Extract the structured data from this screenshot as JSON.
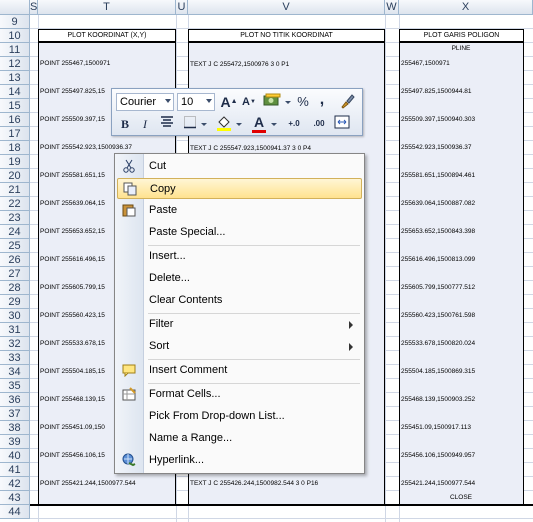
{
  "columns": [
    "S",
    "T",
    "U",
    "V",
    "W",
    "X"
  ],
  "rows": [
    "9",
    "10",
    "11",
    "12",
    "13",
    "14",
    "15",
    "16",
    "17",
    "18",
    "19",
    "20",
    "21",
    "22",
    "23",
    "24",
    "25",
    "26",
    "27",
    "28",
    "29",
    "30",
    "31",
    "32",
    "33",
    "34",
    "35",
    "36",
    "37",
    "38",
    "39",
    "40",
    "41",
    "42",
    "43",
    "44"
  ],
  "headers": {
    "plot_koordinat": "PLOT KOORDINAT (X,Y)",
    "plot_no_titik": "PLOT NO TITIK KOORDINAT",
    "plot_garis": "PLOT GARIS POLIGON"
  },
  "col_t": [
    "POINT 255467,1500971",
    "POINT 255497.825,15",
    "POINT 255509.397,15",
    "POINT 255542.923,1500936.37",
    "POINT 255581.651,15",
    "POINT 255639.064,15",
    "POINT 255653.652,15",
    "POINT 255616.496,15",
    "POINT 255605.799,15",
    "POINT 255560.423,15",
    "POINT 255533.678,15",
    "POINT 255504.185,15",
    "POINT 255468.139,15",
    "POINT 255451.09,150",
    "POINT 255456.106,15",
    "POINT 255421.244,1500977.544"
  ],
  "col_v": [
    "TEXT J C 255472,1500976 3 0  P1",
    "TEXT J C 255547.923,1500941.37 3 0  P4",
    "TEXT J C 255426.244,1500982.544 3 0  P16"
  ],
  "col_x": {
    "pline": "PLINE",
    "close": "CLOSE",
    "values": [
      "255467,1500971",
      "255497.825,1500944.81",
      "255509.397,1500940.303",
      "255542.923,1500936.37",
      "255581.651,1500894.461",
      "255639.064,1500887.082",
      "255653.652,1500843.398",
      "255616.496,1500813.099",
      "255605.799,1500777.512",
      "255560.423,1500761.598",
      "255533.678,1500820.024",
      "255504.185,1500869.315",
      "255468.139,1500903.252",
      "255451.09,1500917.113",
      "255456.106,1500949.957",
      "255421.244,1500977.544"
    ]
  },
  "toolbar": {
    "font": "Courier",
    "size": "10",
    "grow": "A",
    "shrink": "A",
    "percent": "%",
    "comma": ",",
    "bold": "B",
    "italic": "I",
    "font_color_letter": "A",
    "inc_decimal": "+.0",
    "dec_decimal": ".00"
  },
  "menu": {
    "items": [
      {
        "label": "Cut"
      },
      {
        "label": "Copy"
      },
      {
        "label": "Paste"
      },
      {
        "label": "Paste Special..."
      },
      {
        "label": "Insert..."
      },
      {
        "label": "Delete..."
      },
      {
        "label": "Clear Contents"
      },
      {
        "label": "Filter"
      },
      {
        "label": "Sort"
      },
      {
        "label": "Insert Comment"
      },
      {
        "label": "Format Cells..."
      },
      {
        "label": "Pick From Drop-down List..."
      },
      {
        "label": "Name a Range..."
      },
      {
        "label": "Hyperlink..."
      }
    ]
  },
  "colors": {
    "table_fill": "#ebeef7",
    "highlight": "#ffe28f",
    "header_fill": "#dde4ee"
  }
}
